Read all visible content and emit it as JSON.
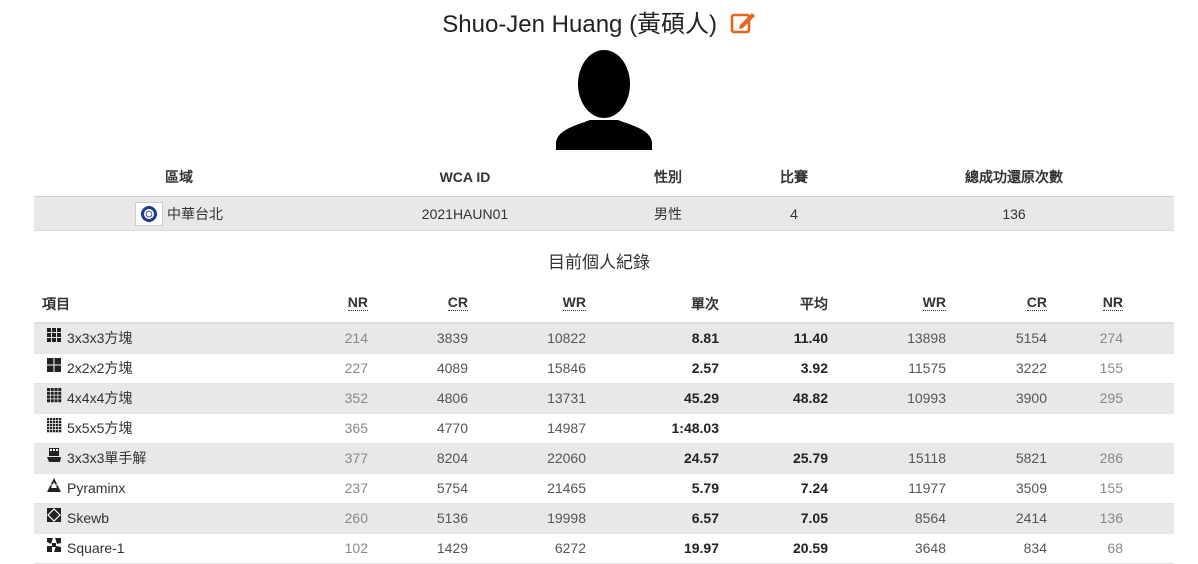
{
  "person": {
    "name": "Shuo-Jen Huang (黃碩人)"
  },
  "info": {
    "headers": [
      "區域",
      "WCA ID",
      "性別",
      "比賽",
      "總成功還原次數"
    ],
    "region": "中華台北",
    "wca_id": "2021HAUN01",
    "gender": "男性",
    "competitions": "4",
    "solves": "136"
  },
  "records_title": "目前個人紀錄",
  "records_headers": {
    "event": "項目",
    "nr_single": "NR",
    "cr_single": "CR",
    "wr_single": "WR",
    "single": "單次",
    "average": "平均",
    "wr_avg": "WR",
    "cr_avg": "CR",
    "nr_avg": "NR"
  },
  "records": [
    {
      "event": "3x3x3方塊",
      "icon": "cube-3x3-icon",
      "nr1": "214",
      "cr1": "3839",
      "wr1": "10822",
      "single": "8.81",
      "average": "11.40",
      "wr2": "13898",
      "cr2": "5154",
      "nr2": "274"
    },
    {
      "event": "2x2x2方塊",
      "icon": "cube-2x2-icon",
      "nr1": "227",
      "cr1": "4089",
      "wr1": "15846",
      "single": "2.57",
      "average": "3.92",
      "wr2": "11575",
      "cr2": "3222",
      "nr2": "155"
    },
    {
      "event": "4x4x4方塊",
      "icon": "cube-4x4-icon",
      "nr1": "352",
      "cr1": "4806",
      "wr1": "13731",
      "single": "45.29",
      "average": "48.82",
      "wr2": "10993",
      "cr2": "3900",
      "nr2": "295"
    },
    {
      "event": "5x5x5方塊",
      "icon": "cube-5x5-icon",
      "nr1": "365",
      "cr1": "4770",
      "wr1": "14987",
      "single": "1:48.03",
      "average": "",
      "wr2": "",
      "cr2": "",
      "nr2": ""
    },
    {
      "event": "3x3x3單手解",
      "icon": "one-hand-icon",
      "nr1": "377",
      "cr1": "8204",
      "wr1": "22060",
      "single": "24.57",
      "average": "25.79",
      "wr2": "15118",
      "cr2": "5821",
      "nr2": "286"
    },
    {
      "event": "Pyraminx",
      "icon": "pyraminx-icon",
      "nr1": "237",
      "cr1": "5754",
      "wr1": "21465",
      "single": "5.79",
      "average": "7.24",
      "wr2": "11977",
      "cr2": "3509",
      "nr2": "155"
    },
    {
      "event": "Skewb",
      "icon": "skewb-icon",
      "nr1": "260",
      "cr1": "5136",
      "wr1": "19998",
      "single": "6.57",
      "average": "7.05",
      "wr2": "8564",
      "cr2": "2414",
      "nr2": "136"
    },
    {
      "event": "Square-1",
      "icon": "square-1-icon",
      "nr1": "102",
      "cr1": "1429",
      "wr1": "6272",
      "single": "19.97",
      "average": "20.59",
      "wr2": "3648",
      "cr2": "834",
      "nr2": "68"
    }
  ]
}
